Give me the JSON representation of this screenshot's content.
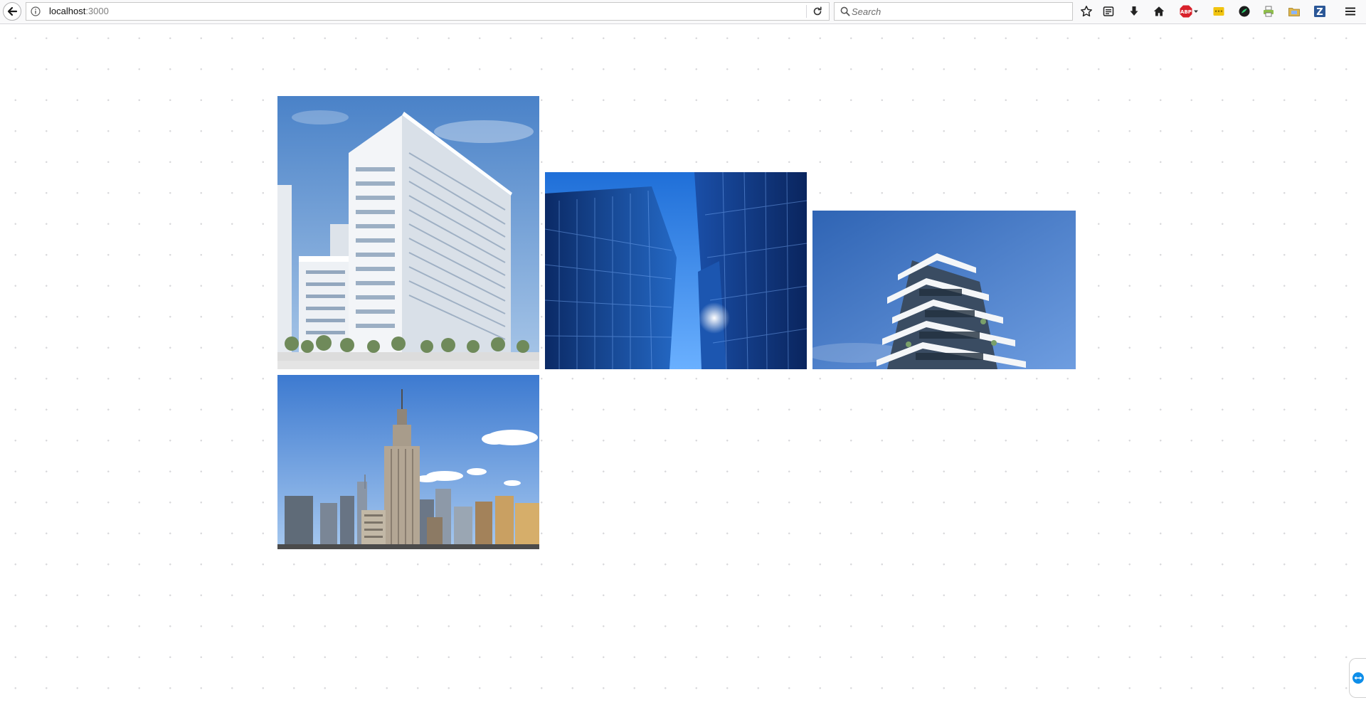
{
  "browser": {
    "url_host": "localhost",
    "url_port": ":3000",
    "search_placeholder": "Search",
    "icons": {
      "back": "back-arrow-icon",
      "info": "info-icon",
      "reload": "reload-icon",
      "search": "search-icon",
      "bookmark": "bookmark-star-icon",
      "reading_list": "reading-list-icon",
      "downloads": "download-icon",
      "home": "home-icon",
      "adblock": "adblock-plus-icon",
      "adblock_label": "ABP",
      "extension_1": "extension-yellow-icon",
      "extension_2": "extension-green-circle-icon",
      "extension_3": "extension-printer-icon",
      "extension_4": "extension-folder-icon",
      "zotero": "zotero-icon",
      "zotero_label": "Z",
      "menu": "hamburger-menu-icon"
    },
    "colors": {
      "abp_red": "#d8212b",
      "zotero_blue": "#2b5797",
      "sky_blue": "#4a82c8"
    }
  },
  "gallery": {
    "images": [
      {
        "subject": "white-office-tower-photo"
      },
      {
        "subject": "blue-glass-skyscrapers-photo"
      },
      {
        "subject": "modern-balcony-apartment-building-photo"
      },
      {
        "subject": "empire-state-skyline-photo"
      }
    ]
  },
  "side_widget": {
    "icon": "teamviewer-icon"
  }
}
